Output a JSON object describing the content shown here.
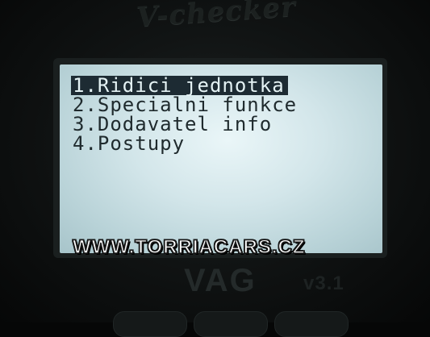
{
  "device": {
    "brand_logo": "V-checker",
    "model_label": "VAG",
    "version_label": "v3.1"
  },
  "screen": {
    "menu": {
      "items": [
        {
          "label": "1.Ridici jednotka",
          "selected": true
        },
        {
          "label": "2.Specialni funkce",
          "selected": false
        },
        {
          "label": "3.Dodavatel info",
          "selected": false
        },
        {
          "label": "4.Postupy",
          "selected": false
        }
      ]
    }
  },
  "watermark": "WWW.TORRIACARS.CZ",
  "colors": {
    "lcd_background": "#d3e6ea",
    "lcd_text": "#1f2a2d",
    "selection_background": "#1d2b33",
    "device_body": "#111414"
  }
}
